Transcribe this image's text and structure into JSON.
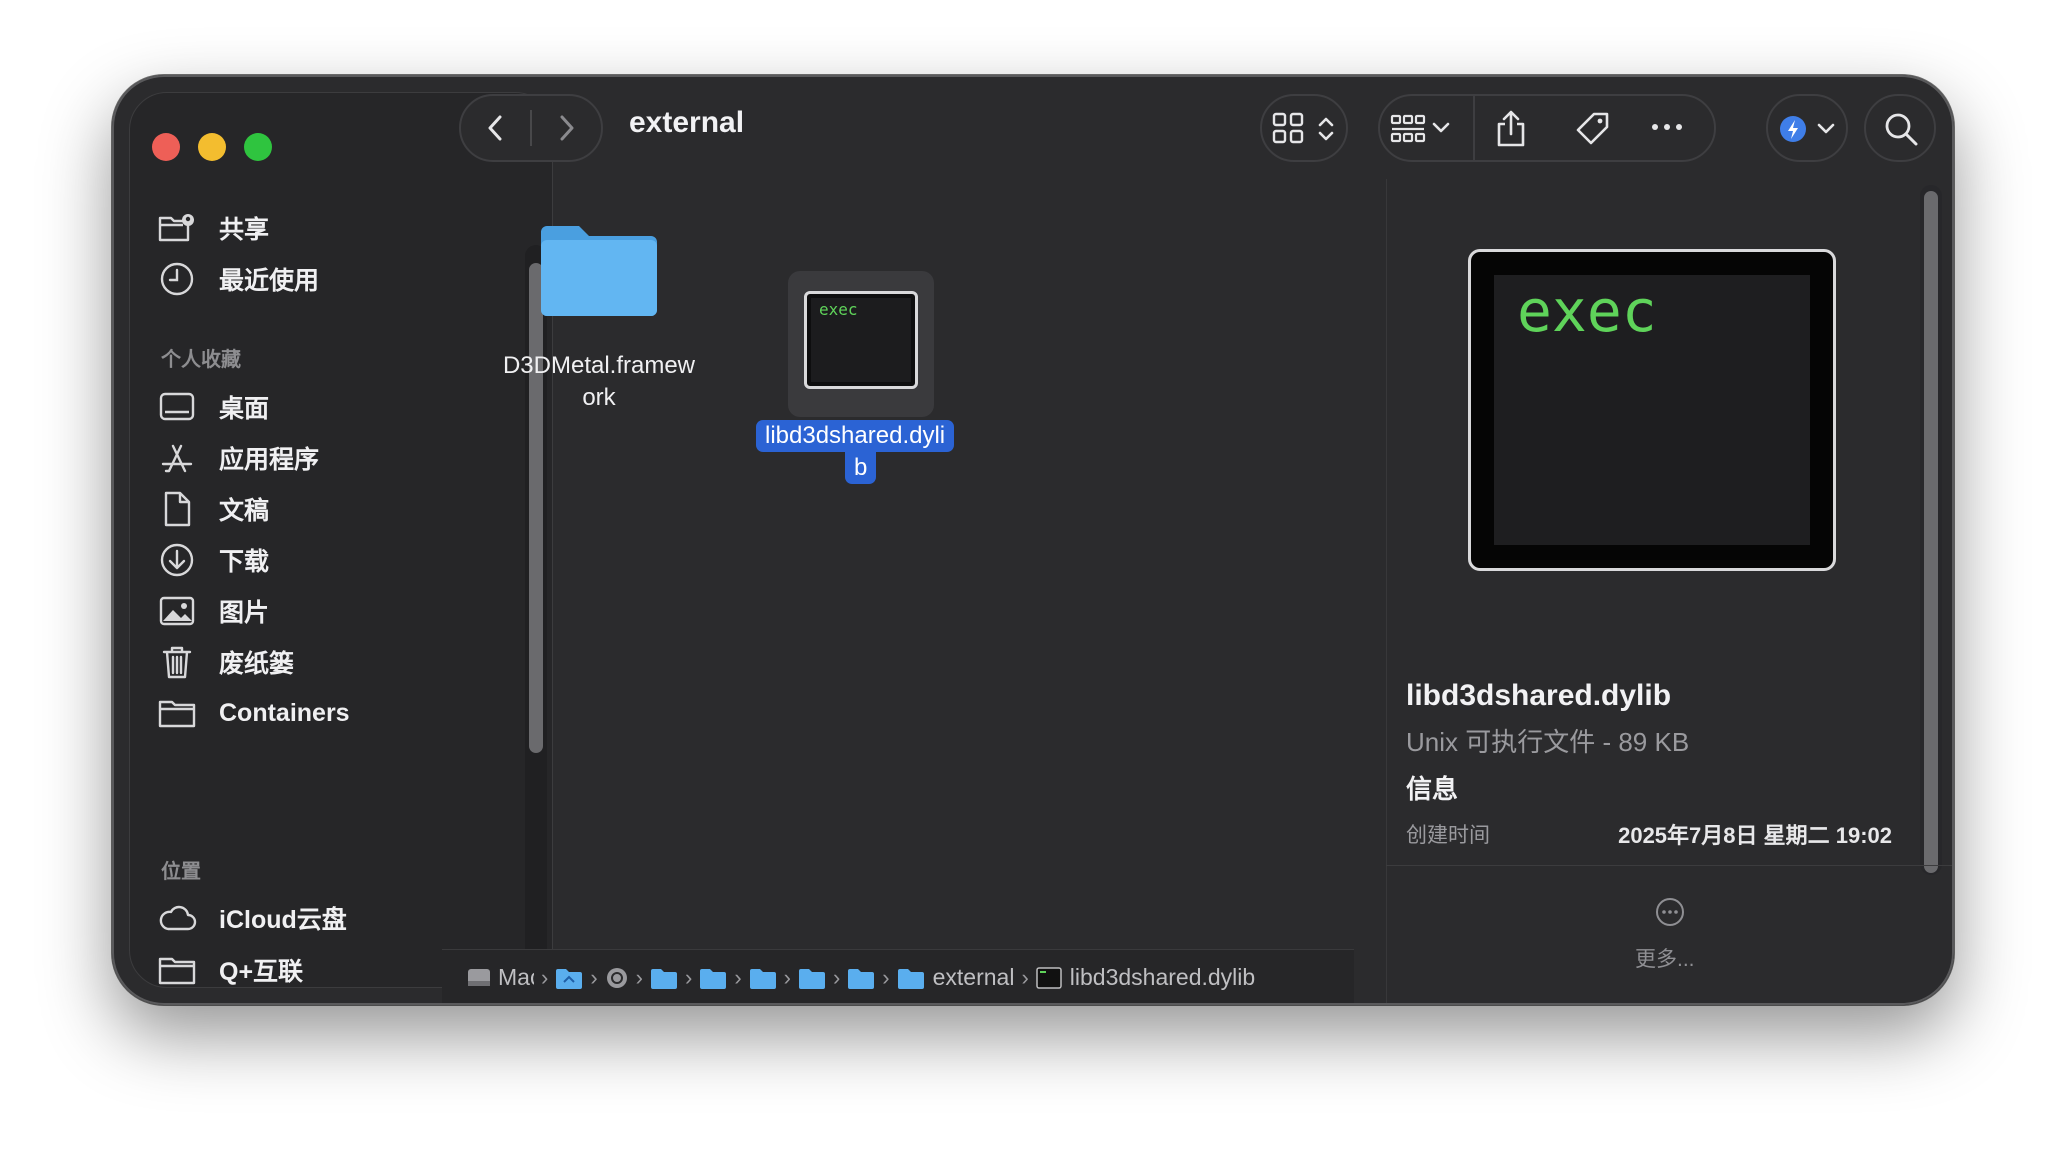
{
  "window": {
    "title": "external"
  },
  "sidebar": {
    "items_top": [
      {
        "label": "共享",
        "icon": "shared-folder-icon"
      },
      {
        "label": "最近使用",
        "icon": "clock-icon"
      }
    ],
    "favorites_header": "个人收藏",
    "favorites": [
      {
        "label": "桌面",
        "icon": "desktop-icon"
      },
      {
        "label": "应用程序",
        "icon": "applications-icon"
      },
      {
        "label": "文稿",
        "icon": "document-icon"
      },
      {
        "label": "下载",
        "icon": "download-icon"
      },
      {
        "label": "图片",
        "icon": "photo-icon"
      },
      {
        "label": "废纸篓",
        "icon": "trash-icon"
      },
      {
        "label": "Containers",
        "icon": "folder-icon"
      }
    ],
    "locations_header": "位置",
    "locations": [
      {
        "label": "iCloud云盘",
        "icon": "cloud-icon"
      },
      {
        "label": "Q+互联",
        "icon": "folder-icon"
      }
    ]
  },
  "files": [
    {
      "name_line1": "D3DMetal.framew",
      "name_line2": "ork",
      "kind": "folder"
    },
    {
      "name_line1": "libd3dshared.dyli",
      "name_line2": "b",
      "kind": "exec",
      "thumb_text": "exec",
      "selected": true
    }
  ],
  "pathbar": {
    "root": "Mac",
    "current_folder": "external",
    "file": "libd3dshared.dylib"
  },
  "preview": {
    "thumb_text": "exec",
    "file_name": "libd3dshared.dylib",
    "kind_size": "Unix 可执行文件 - 89 KB",
    "info_header": "信息",
    "created_label": "创建时间",
    "created_value": "2025年7月8日 星期二 19:02",
    "more_label": "更多..."
  },
  "colors": {
    "accent": "#2b63d4",
    "exec_green": "#5fd35a",
    "folder_blue": "#62b6f2"
  }
}
